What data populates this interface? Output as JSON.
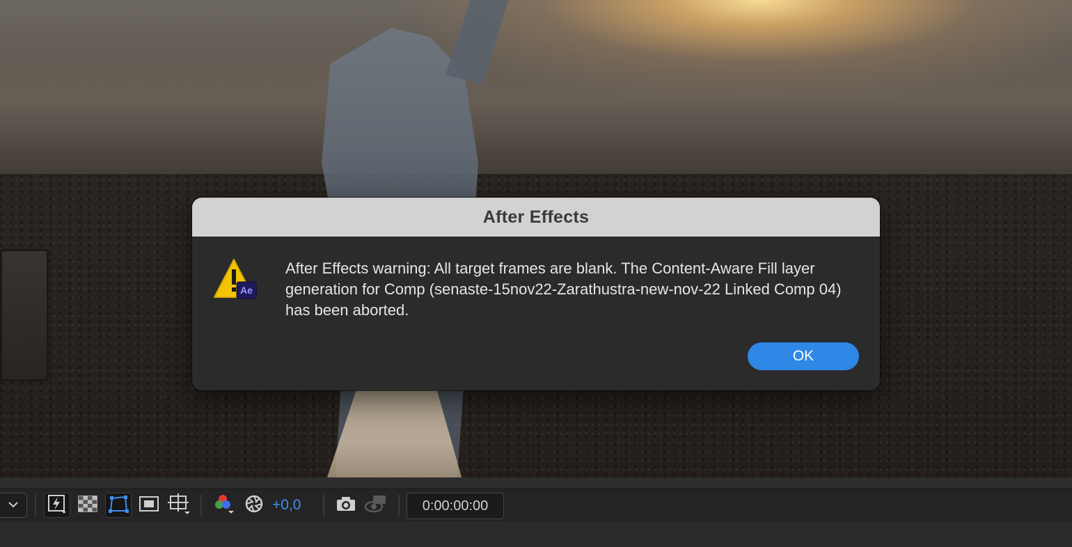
{
  "dialog": {
    "title": "After Effects",
    "message": "After Effects warning: All target frames are blank. The Content-Aware Fill layer generation for Comp (senaste-15nov22-Zarathustra-new-nov-22 Linked Comp 04) has been aborted.",
    "ok_label": "OK",
    "icon": "warning-triangle-with-ae-badge-icon",
    "icon_badge": "Ae"
  },
  "toolbar": {
    "exposure_value": "+0,0",
    "timecode": "0:00:00:00",
    "icons": [
      "chevron-down-icon",
      "fast-previews-icon",
      "transparency-grid-icon",
      "mask-path-visibility-icon",
      "region-of-interest-icon",
      "title-action-safe-icon",
      "color-channels-icon",
      "color-management-icon",
      "snapshot-camera-icon",
      "show-snapshot-icon"
    ]
  },
  "colors": {
    "accent_blue": "#2f87e6",
    "exposure_blue": "#3e8ef0",
    "warning_yellow": "#f2c500",
    "ae_badge_bg": "#1f1a5c",
    "ae_badge_text": "#9999ff"
  }
}
